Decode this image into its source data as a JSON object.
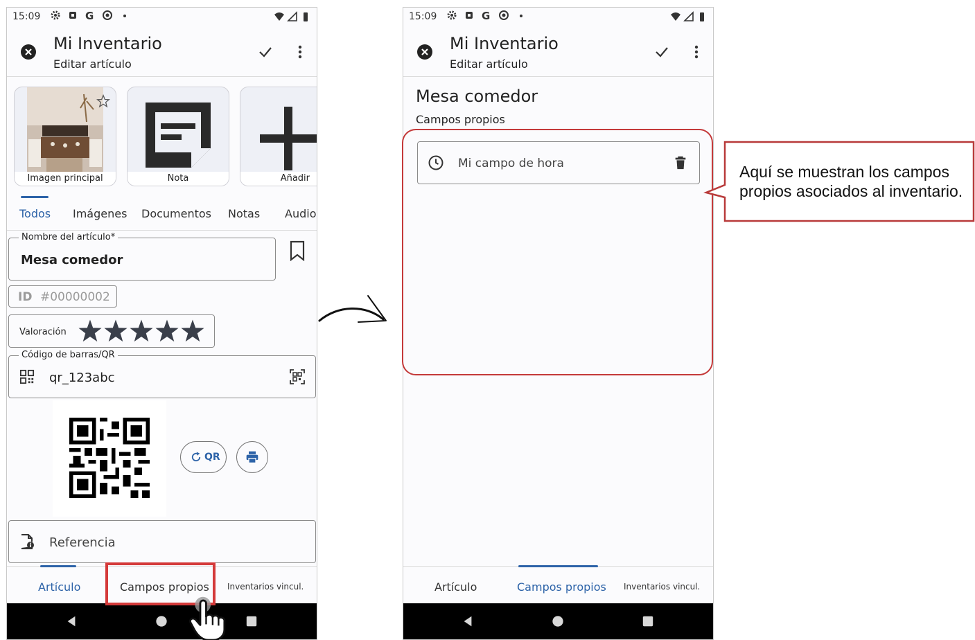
{
  "status_time": "15:09",
  "app": {
    "title": "Mi Inventario",
    "subtitle": "Editar artículo"
  },
  "media": [
    {
      "label": "Imagen principal"
    },
    {
      "label": "Nota"
    },
    {
      "label": "Añadir"
    }
  ],
  "tabs": [
    "Todos",
    "Imágenes",
    "Documentos",
    "Notas",
    "Audio"
  ],
  "name_field": {
    "label": "Nombre del artículo*",
    "value": "Mesa comedor"
  },
  "id_field": {
    "label": "ID",
    "value": "#00000002"
  },
  "rating": {
    "label": "Valoración",
    "stars": 5,
    "max": 5
  },
  "barcode_field": {
    "label": "Código de barras/QR",
    "value": "qr_123abc"
  },
  "qr_button": "QR",
  "reference_field": {
    "placeholder": "Referencia"
  },
  "bottom_nav": [
    "Artículo",
    "Campos propios",
    "Inventarios vincul."
  ],
  "right": {
    "item_title": "Mesa comedor",
    "section_label": "Campos propios",
    "custom_field": "Mi campo de hora"
  },
  "callout": {
    "line1": "Aquí se muestran los campos",
    "line2": "propios asociados al inventario."
  },
  "colors": {
    "accent": "#2d63a8",
    "highlight": "#d43a3a",
    "callout_border": "#b83a3a"
  }
}
